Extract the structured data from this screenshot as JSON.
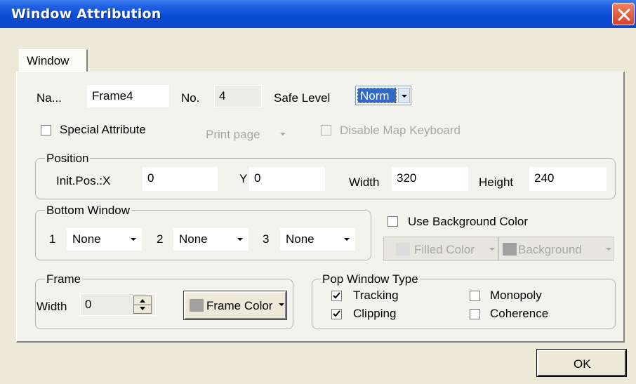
{
  "window": {
    "title": "Window Attribution"
  },
  "tabs": [
    {
      "label": "Window"
    }
  ],
  "general": {
    "name_label": "Na...",
    "name_value": "Frame4",
    "no_label": "No.",
    "no_value": "4",
    "safe_level_label": "Safe Level",
    "safe_level_value": "Norm",
    "special_attribute_label": "Special Attribute",
    "special_attribute_checked": false,
    "print_page_label": "Print page",
    "disable_map_keyboard_label": "Disable Map Keyboard"
  },
  "position": {
    "legend": "Position",
    "init_x_label": "Init.Pos.:X",
    "x_value": "0",
    "y_label": "Y",
    "y_value": "0",
    "width_label": "Width",
    "width_value": "320",
    "height_label": "Height",
    "height_value": "240"
  },
  "bottom_window": {
    "legend": "Bottom Window",
    "slots": [
      {
        "index": "1",
        "value": "None"
      },
      {
        "index": "2",
        "value": "None"
      },
      {
        "index": "3",
        "value": "None"
      }
    ]
  },
  "background": {
    "use_background_color_label": "Use Background Color",
    "checked": false,
    "filled_color_label": "Filled Color",
    "background_label": "Background",
    "filled_swatch_color": "#dcdcdc",
    "background_swatch_color": "#a0a0a0"
  },
  "frame": {
    "legend": "Frame",
    "width_label": "Width",
    "width_value": "0",
    "frame_color_label": "Frame Color",
    "frame_swatch_color": "#a0a0a0"
  },
  "pop_window_type": {
    "legend": "Pop Window Type",
    "tracking_label": "Tracking",
    "tracking_checked": true,
    "clipping_label": "Clipping",
    "clipping_checked": true,
    "monopoly_label": "Monopoly",
    "monopoly_checked": false,
    "coherence_label": "Coherence",
    "coherence_checked": false
  },
  "footer": {
    "ok_label": "OK"
  }
}
